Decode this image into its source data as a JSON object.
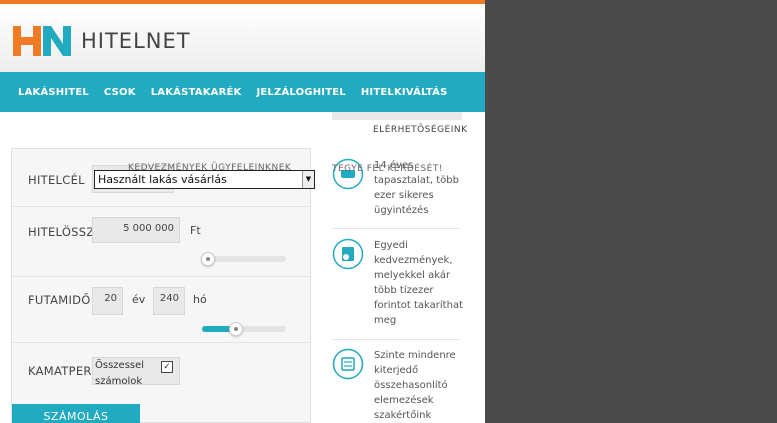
{
  "brand": {
    "name": "HITELNET",
    "mark": "HN",
    "colors": {
      "orange": "#f07b26",
      "blue": "#22aac0",
      "dark_panel": "#4a4a4a"
    }
  },
  "nav": {
    "items": [
      {
        "label": "LAKÁSHITEL"
      },
      {
        "label": "CSOK"
      },
      {
        "label": "LAKÁSTAKARÉK"
      },
      {
        "label": "JELZÁLOGHITEL"
      },
      {
        "label": "HITELKIVÁLTÁS"
      }
    ]
  },
  "form": {
    "overlap_heading": "KEDVEZMÉNYEK ÜGYFELEINKNEK",
    "loan_purpose": {
      "label": "HITELCÉL",
      "selected": "Használt lakás vásárlás"
    },
    "loan_amount": {
      "label": "HITELÖSSZ",
      "value": "5 000 000",
      "unit": "Ft",
      "slider_fraction": 0.0
    },
    "term": {
      "label": "FUTAMIDŐ",
      "years": "20",
      "years_unit": "év",
      "months": "240",
      "months_unit": "hó",
      "slider_fraction": 0.4
    },
    "interest": {
      "label": "KAMATPER",
      "option_line1": "Összessel",
      "option_line2": "számolok",
      "checked": true
    },
    "calc_button": "SZÁMOLÁS"
  },
  "sidebar": {
    "contacts_label": "ELÉRHETŐSÉGEINK",
    "overlap_heading": "TEGYE FEL KÉRDÉSÉT!",
    "features": [
      {
        "icon": "handshake-icon",
        "text": "14 éves tapasztalat, több ezer sikeres ügyintézés"
      },
      {
        "icon": "money-icon",
        "text": "Egyedi kedvezmények, melyekkel akár több tízezer forintot takaríthat meg"
      },
      {
        "icon": "calculator-icon",
        "text": "Szinte mindenre kiterjedő összehasonlító elemezések szakértőink"
      }
    ]
  }
}
